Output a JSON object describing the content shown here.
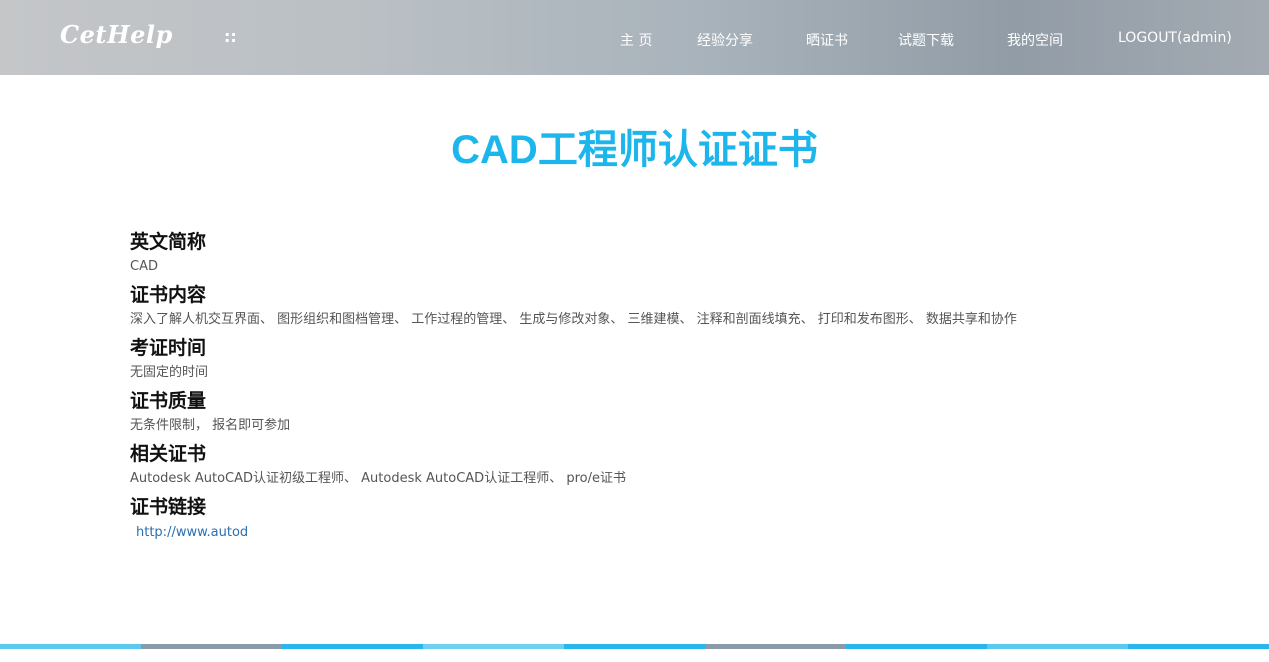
{
  "header": {
    "logo": "CetHelp",
    "logo_dots": "::",
    "nav": [
      {
        "label": "主 页"
      },
      {
        "label": "经验分享"
      },
      {
        "label": "晒证书"
      },
      {
        "label": "试题下载"
      },
      {
        "label": "我的空间"
      },
      {
        "label": "LOGOUT(admin)"
      }
    ]
  },
  "main": {
    "title": "CAD工程师认证证书",
    "sections": [
      {
        "heading": "英文简称",
        "text": "CAD"
      },
      {
        "heading": "证书内容",
        "text": "深入了解人机交互界面、 图形组织和图档管理、 工作过程的管理、 生成与修改对象、 三维建模、 注释和剖面线填充、 打印和发布图形、 数据共享和协作"
      },
      {
        "heading": "考证时间",
        "text": "无固定的时间"
      },
      {
        "heading": "证书质量",
        "text": "无条件限制， 报名即可参加"
      },
      {
        "heading": "相关证书",
        "text": "Autodesk AutoCAD认证初级工程师、 Autodesk AutoCAD认证工程师、 pro/e证书"
      },
      {
        "heading": "证书链接",
        "link": "http://www.autod"
      }
    ]
  },
  "colors": {
    "title": "#1cb6ec",
    "link": "#2a6fb3",
    "footer_segments": [
      "#5bc8ee",
      "#8a9aa8",
      "#29b6ec",
      "#6fd0f2",
      "#29b6ec",
      "#8a9aa8",
      "#29b6ec",
      "#5bc8ee",
      "#29b6ec"
    ]
  }
}
